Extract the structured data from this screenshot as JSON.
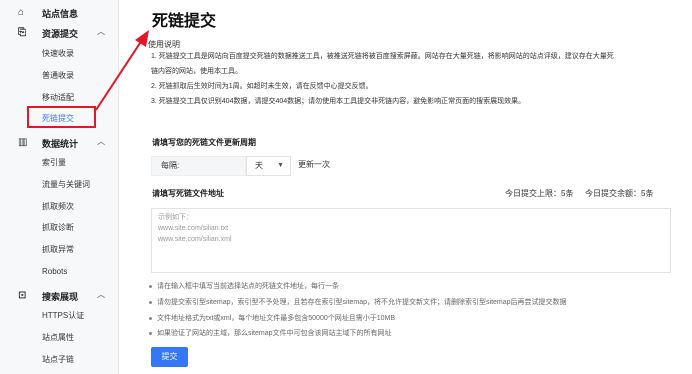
{
  "sidebar": {
    "site_info": "站点信息",
    "resource_submit": {
      "title": "资源提交",
      "items": [
        "快速收录",
        "普通收录",
        "移动适配",
        "死链提交"
      ]
    },
    "data_stats": {
      "title": "数据统计",
      "items": [
        "索引量",
        "流量与关键词",
        "抓取频次",
        "抓取诊断",
        "抓取异常",
        "Robots"
      ]
    },
    "search_display": {
      "title": "搜索展现",
      "items": [
        "HTTPS认证",
        "站点属性",
        "站点子链"
      ]
    }
  },
  "main": {
    "title": "死链提交",
    "usage_title": "使用说明",
    "usage_lines": [
      "1. 死链提交工具是网站向百度提交死链的数据推送工具，被推送死链将被百度搜索屏蔽。网站存在大量死链，将影响网站的站点评级，建议存在大量死",
      "链内容的网站，使用本工具。",
      "2. 死链抓取后生效时间为1周。如超时未生效，请在反馈中心提交反馈。",
      "3. 死链提交工具仅识别404数据，请提交404数据；请勿使用本工具提交非死链内容，避免影响正常页面的搜索展现效果。"
    ],
    "update_period_label": "请填写您的死链文件更新周期",
    "frequency_prefix": "每隔:",
    "frequency_unit": "天",
    "frequency_suffix": "更新一次",
    "file_address_label": "请填写死链文件地址",
    "quota_today_limit": "今日提交上限：",
    "quota_today_limit_value": "5条",
    "quota_today_remaining": "今日提交余额：",
    "quota_today_remaining_value": "5条",
    "textarea_placeholder_lines": [
      "示例如下：",
      "www.site.com/silian.txt",
      "www.site.com/silian.xml"
    ],
    "tips": [
      "请在输入框中填写当前选择站点的死链文件地址，每行一条",
      "请勿提交索引型sitemap，索引型不予处理，且若存在索引型sitemap，将不允许提交新文件；请删除索引型sitemap后再尝试提交数据",
      "文件地址格式为txt或xml，每个地址文件最多包含50000个网址且需小于10MB",
      "如果验证了网站的主域，那么sitemap文件中可包含该网站主域下的所有网址"
    ],
    "submit_label": "提交"
  },
  "colors": {
    "accent": "#3478f6",
    "annotation": "#e0182a"
  },
  "icons": [
    "home-icon",
    "upload-icon",
    "bar-chart-icon",
    "search-display-icon",
    "chevron-up-icon",
    "chevron-down-icon",
    "caret-down-icon"
  ]
}
